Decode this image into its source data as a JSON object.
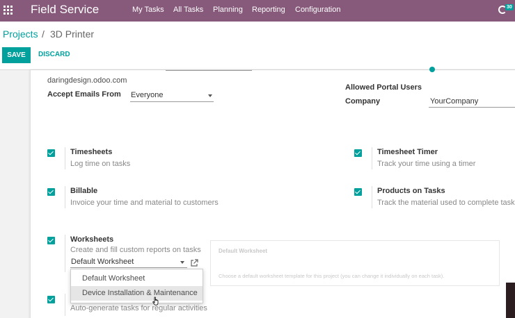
{
  "navbar": {
    "app_name": "Field Service",
    "menu": [
      "My Tasks",
      "All Tasks",
      "Planning",
      "Reporting",
      "Configuration"
    ],
    "activity_count": "30",
    "bg_color": "#875a7b"
  },
  "breadcrumb": {
    "parent": "Projects",
    "separator": "/",
    "current": "3D Printer"
  },
  "buttons": {
    "save": "SAVE",
    "discard": "DISCARD"
  },
  "form": {
    "email_domain": "daringdesign.odoo.com",
    "accept_emails_label": "Accept Emails From",
    "accept_emails_value": "Everyone",
    "allowed_portal_label": "Allowed Portal Users",
    "company_label": "Company",
    "company_value": "YourCompany"
  },
  "settings": [
    {
      "title": "Timesheets",
      "desc": "Log time on tasks",
      "checked": true
    },
    {
      "title": "Timesheet Timer",
      "desc": "Track your time using a timer",
      "checked": true
    },
    {
      "title": "Billable",
      "desc": "Invoice your time and material to customers",
      "checked": true
    },
    {
      "title": "Products on Tasks",
      "desc": "Track the material used to complete tasks",
      "checked": true
    },
    {
      "title": "Worksheets",
      "desc": "Create and fill custom reports on tasks",
      "checked": true,
      "value": "Default Worksheet"
    },
    {
      "title": "",
      "desc": "Auto-generate tasks for regular activities",
      "checked": true
    }
  ],
  "worksheet_box": {
    "title": "Default Worksheet",
    "desc": "Choose a default worksheet template for this project (you can change it individually on each task)."
  },
  "dropdown": {
    "options": [
      "Default Worksheet",
      "Device Installation & Maintenance"
    ],
    "highlighted": "Device Installation & Maintenance"
  },
  "accent_color": "#00a09d"
}
